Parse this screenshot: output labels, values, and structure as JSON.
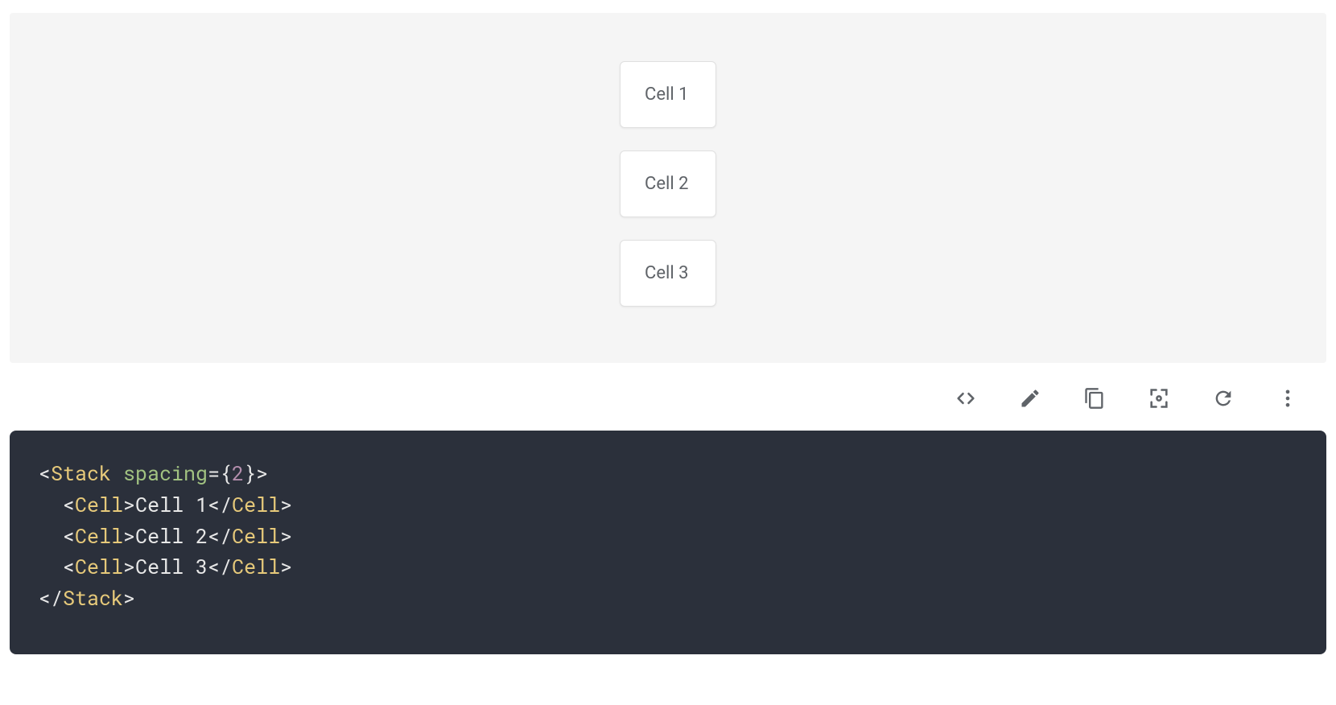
{
  "preview": {
    "cells": [
      "Cell 1",
      "Cell 2",
      "Cell 3"
    ]
  },
  "toolbar": {
    "icons": [
      "code-icon",
      "edit-icon",
      "copy-icon",
      "fullscreen-icon",
      "refresh-icon",
      "more-icon"
    ]
  },
  "code": {
    "stack_open_1": "<",
    "stack_tag": "Stack",
    "space": " ",
    "attr": "spacing",
    "eq": "=",
    "brace_open": "{",
    "num": "2",
    "brace_close": "}",
    "gt": ">",
    "lt": "<",
    "slash_lt": "</",
    "cell_tag": "Cell",
    "cell_texts": [
      "Cell 1",
      "Cell 2",
      "Cell 3"
    ],
    "indent": "  "
  }
}
